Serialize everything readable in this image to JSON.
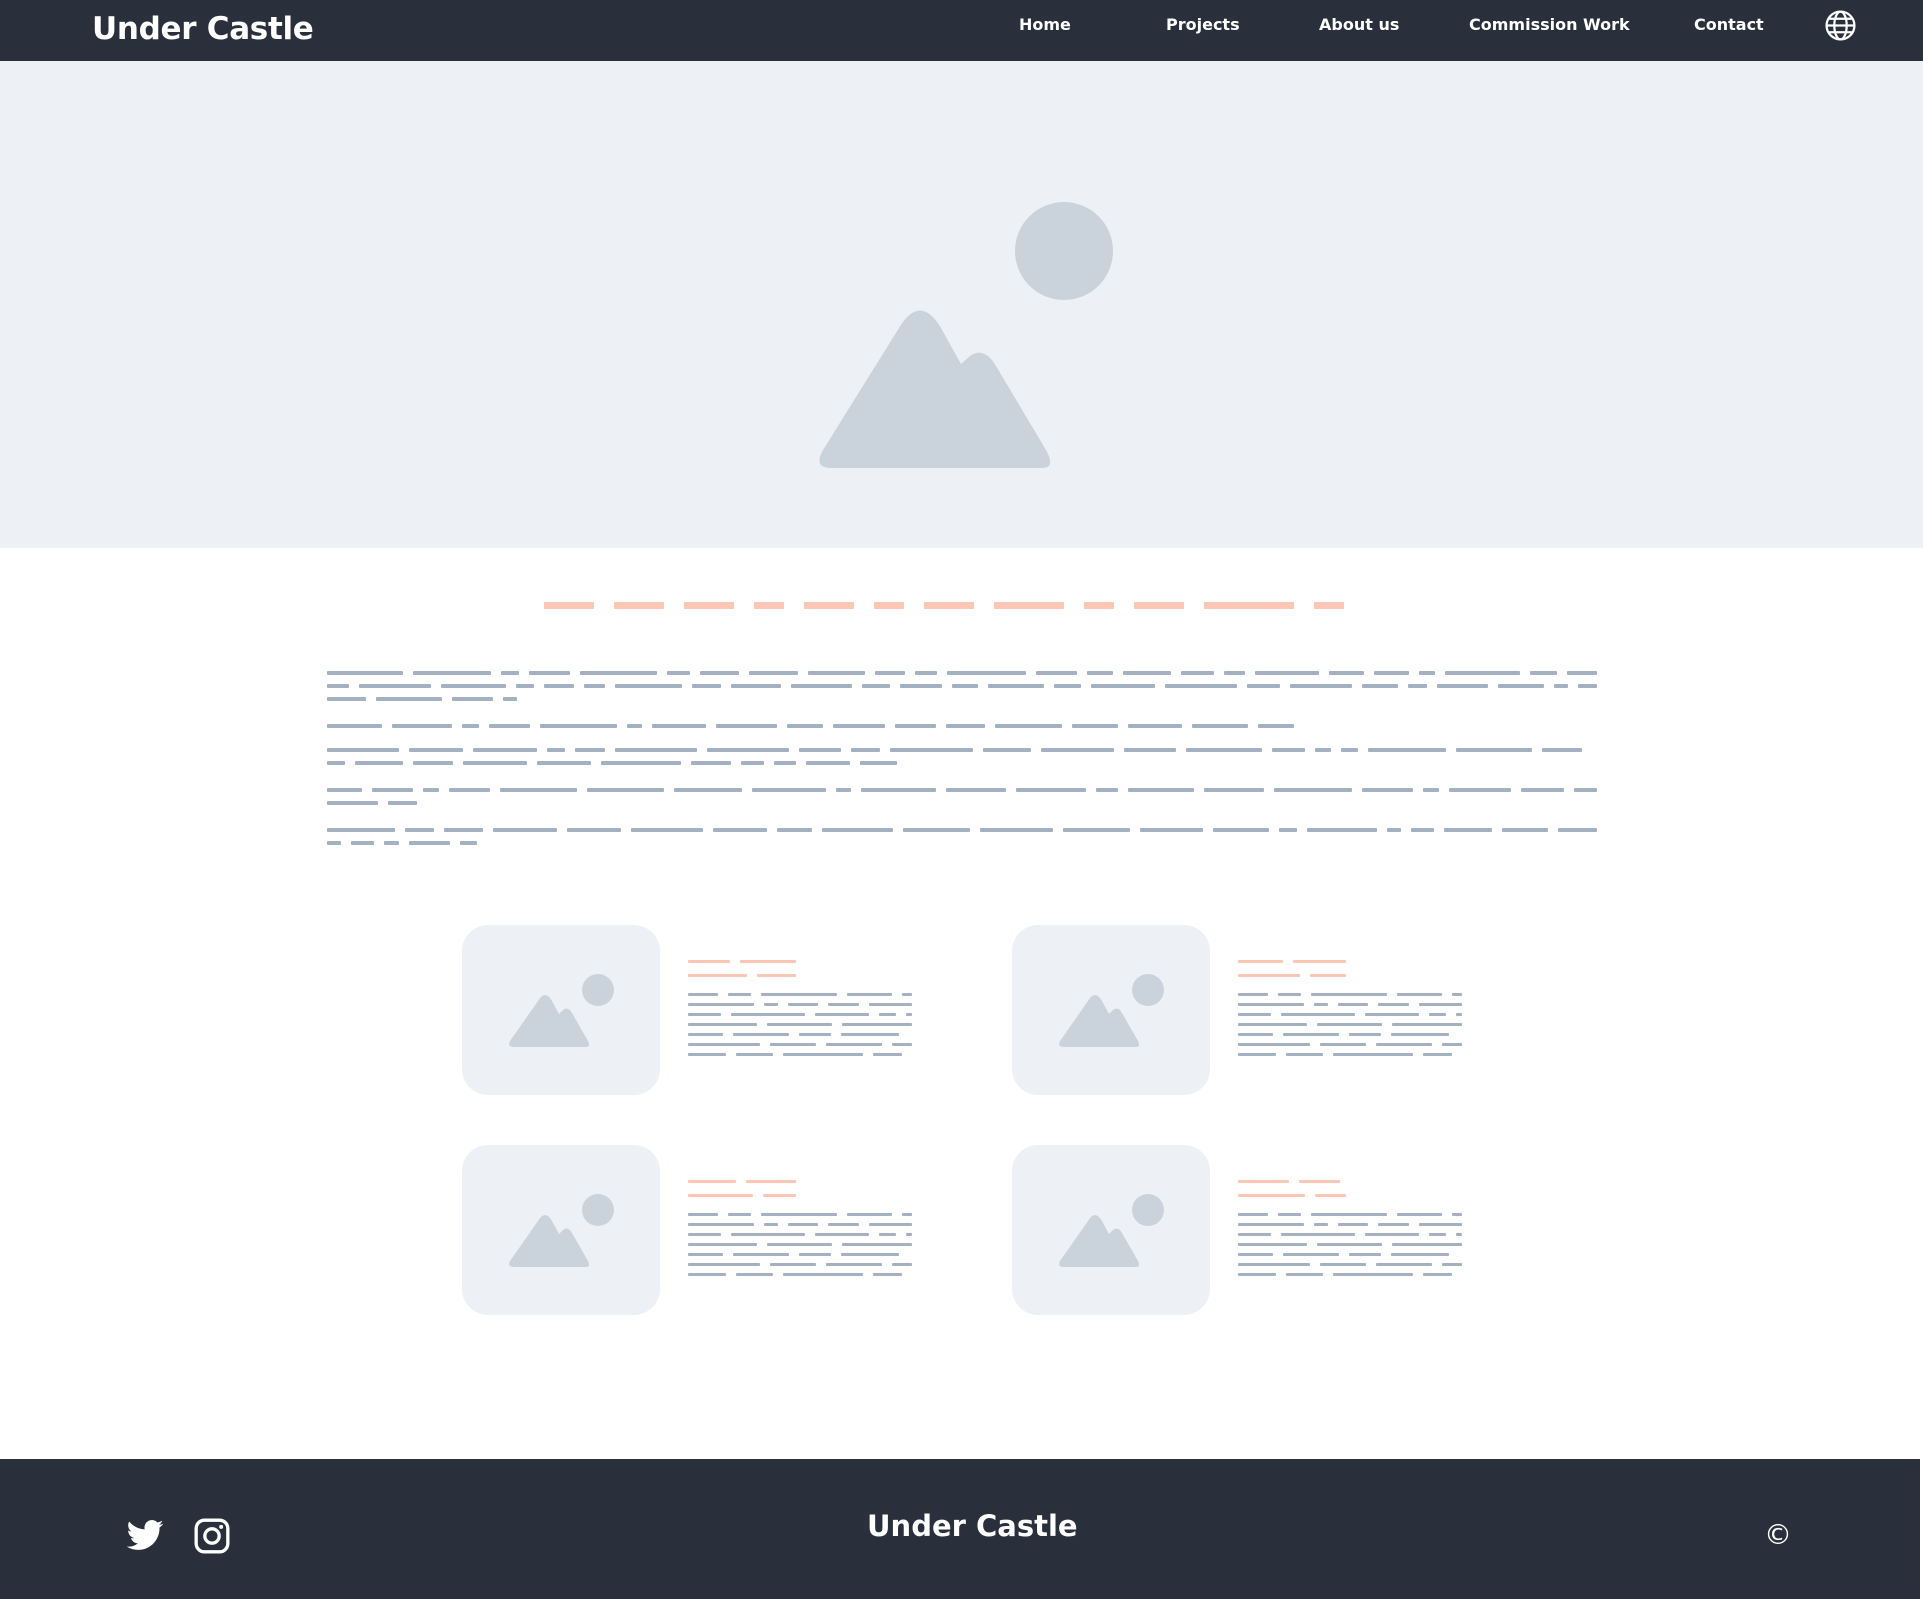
{
  "header": {
    "brand": "Under Castle",
    "nav": [
      {
        "label": "Home"
      },
      {
        "label": "Projects"
      },
      {
        "label": "About us"
      },
      {
        "label": "Commission Work"
      },
      {
        "label": "Contact"
      }
    ],
    "language_icon": "globe-icon"
  },
  "hero": {
    "image_icon": "image-placeholder-icon"
  },
  "cards": [
    {
      "image_icon": "image-placeholder-icon"
    },
    {
      "image_icon": "image-placeholder-icon"
    },
    {
      "image_icon": "image-placeholder-icon"
    },
    {
      "image_icon": "image-placeholder-icon"
    }
  ],
  "footer": {
    "brand": "Under Castle",
    "social": [
      {
        "icon": "twitter-icon"
      },
      {
        "icon": "instagram-icon"
      }
    ],
    "copyright": "©"
  },
  "colors": {
    "header_bg": "#29303b",
    "hero_bg": "#edf0f4",
    "placeholder_shape": "#cad3dc",
    "heading_placeholder": "#fcc6b4",
    "text_placeholder": "#a3b1c2"
  }
}
